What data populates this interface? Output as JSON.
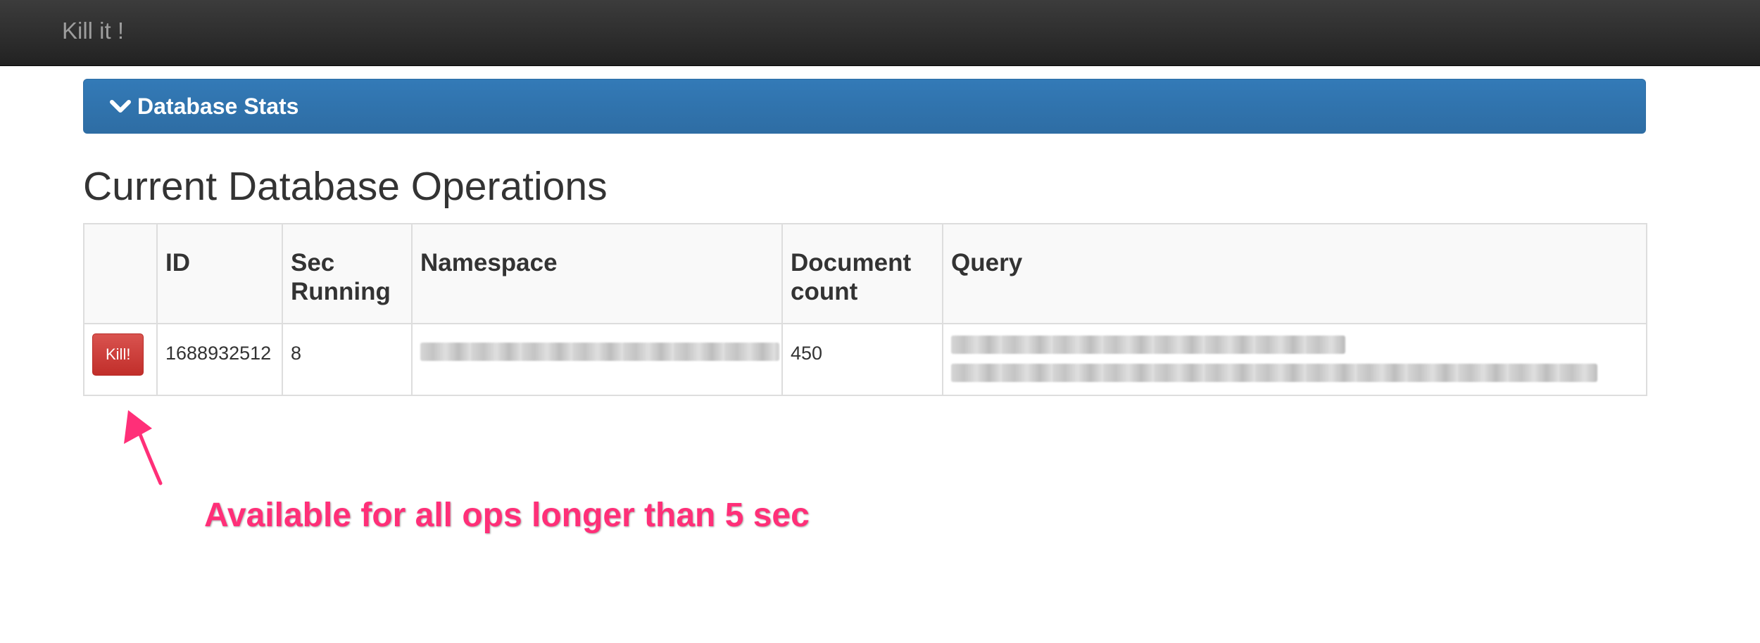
{
  "navbar": {
    "brand": "Kill it !"
  },
  "stats_panel": {
    "title": "Database Stats",
    "toggle_icon": "chevron-down-icon"
  },
  "page": {
    "heading": "Current Database Operations"
  },
  "table": {
    "headers": [
      "",
      "ID",
      "Sec Running",
      "Namespace",
      "Document count",
      "Query"
    ],
    "rows": [
      {
        "action_label": "Kill!",
        "id": "1688932512",
        "sec_running": "8",
        "document_count": "450"
      }
    ]
  },
  "annotation": {
    "text": "Available for all ops longer than 5 sec",
    "color": "#ff2f78"
  },
  "colors": {
    "navbar": "#222222",
    "panel": "#337ab7",
    "danger": "#d9534f"
  }
}
